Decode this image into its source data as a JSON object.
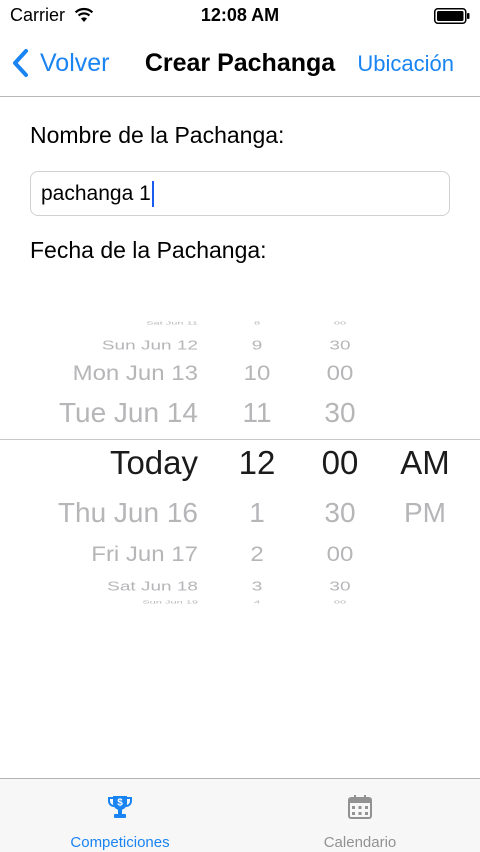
{
  "status_bar": {
    "carrier": "Carrier",
    "time": "12:08 AM",
    "wifi_icon": "wifi-icon",
    "battery_icon": "battery-icon"
  },
  "nav_bar": {
    "back_label": "Volver",
    "back_icon": "chevron-left-icon",
    "title": "Crear Pachanga",
    "right_label": "Ubicación"
  },
  "form": {
    "name_label": "Nombre de la Pachanga:",
    "name_value": "pachanga 1",
    "date_label": "Fecha de la Pachanga:"
  },
  "date_picker": {
    "days": [
      "Sat Jun 11",
      "Sun Jun 12",
      "Mon Jun 13",
      "Tue Jun 14",
      "Today",
      "Thu Jun 16",
      "Fri Jun 17",
      "Sat Jun 18",
      "Sun Jun 19"
    ],
    "hours": [
      "8",
      "9",
      "10",
      "11",
      "12",
      "1",
      "2",
      "3",
      "4"
    ],
    "minutes": [
      "00",
      "30",
      "00",
      "30",
      "00",
      "30",
      "00",
      "30",
      "00"
    ],
    "periods": [
      "",
      "",
      "",
      "",
      "AM",
      "PM",
      "",
      "",
      ""
    ],
    "selected": {
      "day": "Today",
      "hour": "12",
      "minute": "00",
      "period": "AM"
    }
  },
  "tab_bar": {
    "tabs": [
      {
        "label": "Competiciones",
        "icon": "trophy-icon",
        "active": true
      },
      {
        "label": "Calendario",
        "icon": "calendar-icon",
        "active": false
      }
    ]
  },
  "colors": {
    "accent": "#1a84f2",
    "inactive_tab": "#929292",
    "picker_faded": "#b6b6b9"
  }
}
